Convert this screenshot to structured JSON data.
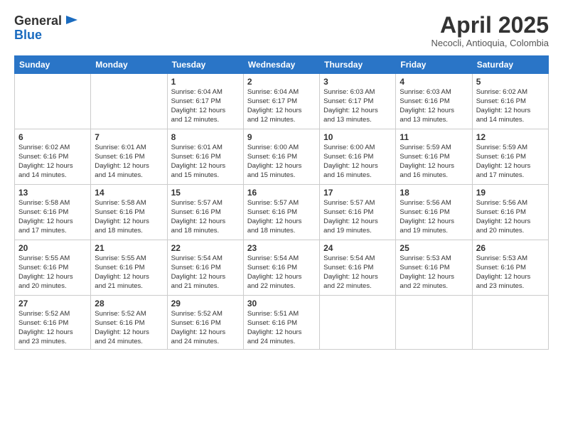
{
  "header": {
    "logo_line1": "General",
    "logo_line2": "Blue",
    "month_title": "April 2025",
    "subtitle": "Necocli, Antioquia, Colombia"
  },
  "days_of_week": [
    "Sunday",
    "Monday",
    "Tuesday",
    "Wednesday",
    "Thursday",
    "Friday",
    "Saturday"
  ],
  "weeks": [
    [
      {
        "num": "",
        "info": ""
      },
      {
        "num": "",
        "info": ""
      },
      {
        "num": "1",
        "info": "Sunrise: 6:04 AM\nSunset: 6:17 PM\nDaylight: 12 hours\nand 12 minutes."
      },
      {
        "num": "2",
        "info": "Sunrise: 6:04 AM\nSunset: 6:17 PM\nDaylight: 12 hours\nand 12 minutes."
      },
      {
        "num": "3",
        "info": "Sunrise: 6:03 AM\nSunset: 6:17 PM\nDaylight: 12 hours\nand 13 minutes."
      },
      {
        "num": "4",
        "info": "Sunrise: 6:03 AM\nSunset: 6:16 PM\nDaylight: 12 hours\nand 13 minutes."
      },
      {
        "num": "5",
        "info": "Sunrise: 6:02 AM\nSunset: 6:16 PM\nDaylight: 12 hours\nand 14 minutes."
      }
    ],
    [
      {
        "num": "6",
        "info": "Sunrise: 6:02 AM\nSunset: 6:16 PM\nDaylight: 12 hours\nand 14 minutes."
      },
      {
        "num": "7",
        "info": "Sunrise: 6:01 AM\nSunset: 6:16 PM\nDaylight: 12 hours\nand 14 minutes."
      },
      {
        "num": "8",
        "info": "Sunrise: 6:01 AM\nSunset: 6:16 PM\nDaylight: 12 hours\nand 15 minutes."
      },
      {
        "num": "9",
        "info": "Sunrise: 6:00 AM\nSunset: 6:16 PM\nDaylight: 12 hours\nand 15 minutes."
      },
      {
        "num": "10",
        "info": "Sunrise: 6:00 AM\nSunset: 6:16 PM\nDaylight: 12 hours\nand 16 minutes."
      },
      {
        "num": "11",
        "info": "Sunrise: 5:59 AM\nSunset: 6:16 PM\nDaylight: 12 hours\nand 16 minutes."
      },
      {
        "num": "12",
        "info": "Sunrise: 5:59 AM\nSunset: 6:16 PM\nDaylight: 12 hours\nand 17 minutes."
      }
    ],
    [
      {
        "num": "13",
        "info": "Sunrise: 5:58 AM\nSunset: 6:16 PM\nDaylight: 12 hours\nand 17 minutes."
      },
      {
        "num": "14",
        "info": "Sunrise: 5:58 AM\nSunset: 6:16 PM\nDaylight: 12 hours\nand 18 minutes."
      },
      {
        "num": "15",
        "info": "Sunrise: 5:57 AM\nSunset: 6:16 PM\nDaylight: 12 hours\nand 18 minutes."
      },
      {
        "num": "16",
        "info": "Sunrise: 5:57 AM\nSunset: 6:16 PM\nDaylight: 12 hours\nand 18 minutes."
      },
      {
        "num": "17",
        "info": "Sunrise: 5:57 AM\nSunset: 6:16 PM\nDaylight: 12 hours\nand 19 minutes."
      },
      {
        "num": "18",
        "info": "Sunrise: 5:56 AM\nSunset: 6:16 PM\nDaylight: 12 hours\nand 19 minutes."
      },
      {
        "num": "19",
        "info": "Sunrise: 5:56 AM\nSunset: 6:16 PM\nDaylight: 12 hours\nand 20 minutes."
      }
    ],
    [
      {
        "num": "20",
        "info": "Sunrise: 5:55 AM\nSunset: 6:16 PM\nDaylight: 12 hours\nand 20 minutes."
      },
      {
        "num": "21",
        "info": "Sunrise: 5:55 AM\nSunset: 6:16 PM\nDaylight: 12 hours\nand 21 minutes."
      },
      {
        "num": "22",
        "info": "Sunrise: 5:54 AM\nSunset: 6:16 PM\nDaylight: 12 hours\nand 21 minutes."
      },
      {
        "num": "23",
        "info": "Sunrise: 5:54 AM\nSunset: 6:16 PM\nDaylight: 12 hours\nand 22 minutes."
      },
      {
        "num": "24",
        "info": "Sunrise: 5:54 AM\nSunset: 6:16 PM\nDaylight: 12 hours\nand 22 minutes."
      },
      {
        "num": "25",
        "info": "Sunrise: 5:53 AM\nSunset: 6:16 PM\nDaylight: 12 hours\nand 22 minutes."
      },
      {
        "num": "26",
        "info": "Sunrise: 5:53 AM\nSunset: 6:16 PM\nDaylight: 12 hours\nand 23 minutes."
      }
    ],
    [
      {
        "num": "27",
        "info": "Sunrise: 5:52 AM\nSunset: 6:16 PM\nDaylight: 12 hours\nand 23 minutes."
      },
      {
        "num": "28",
        "info": "Sunrise: 5:52 AM\nSunset: 6:16 PM\nDaylight: 12 hours\nand 24 minutes."
      },
      {
        "num": "29",
        "info": "Sunrise: 5:52 AM\nSunset: 6:16 PM\nDaylight: 12 hours\nand 24 minutes."
      },
      {
        "num": "30",
        "info": "Sunrise: 5:51 AM\nSunset: 6:16 PM\nDaylight: 12 hours\nand 24 minutes."
      },
      {
        "num": "",
        "info": ""
      },
      {
        "num": "",
        "info": ""
      },
      {
        "num": "",
        "info": ""
      }
    ]
  ]
}
